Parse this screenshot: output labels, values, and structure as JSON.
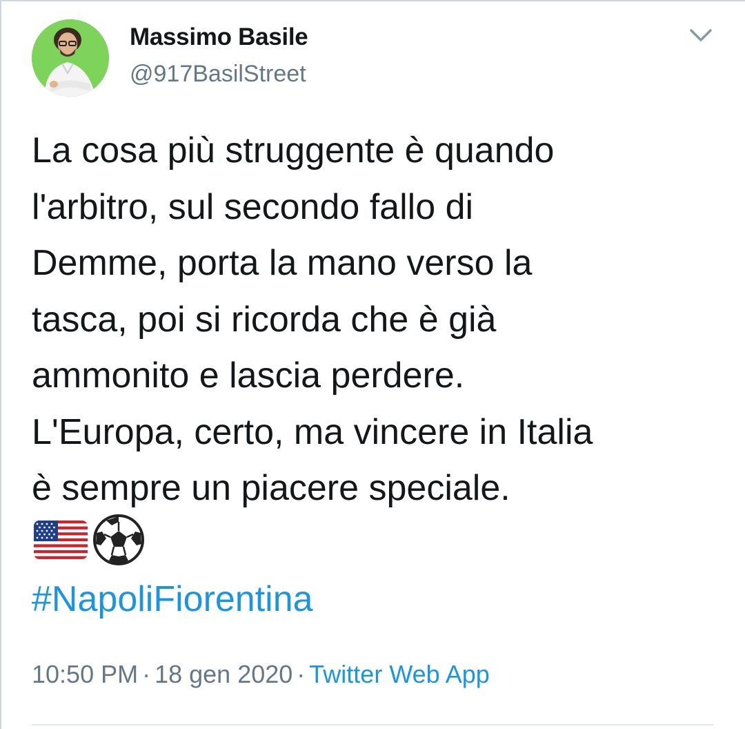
{
  "tweet": {
    "author": {
      "display_name": "Massimo Basile",
      "handle": "@917BasilStreet",
      "avatar_icon": "profile-photo"
    },
    "text_lines": [
      "La cosa più struggente è quando",
      "l'arbitro, sul secondo fallo di",
      "Demme, porta la mano verso la",
      "tasca, poi si ricorda che è già",
      "ammonito e lascia perdere.",
      "L'Europa, certo, ma vincere in Italia",
      "è sempre un piacere speciale."
    ],
    "emojis": [
      "us-flag-icon",
      "soccer-ball-icon"
    ],
    "hashtag": "#NapoliFiorentina",
    "time": "10:50 PM",
    "date": "18 gen 2020",
    "separator": "·",
    "source": "Twitter Web App",
    "menu_icon": "chevron-down-icon"
  },
  "colors": {
    "link": "#1b95e0",
    "muted": "#657786",
    "text": "#14171a",
    "avatar_bg": "#7ed35a"
  }
}
